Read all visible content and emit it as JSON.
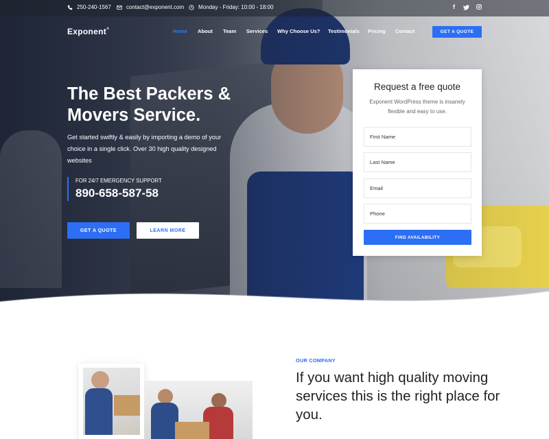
{
  "topbar": {
    "phone": "250-240-1567",
    "email": "contact@exponent.com",
    "hours": "Monday - Friday: 10:00 - 18:00",
    "socials": [
      "facebook-icon",
      "twitter-icon",
      "instagram-icon"
    ]
  },
  "nav": {
    "logo": "Exponent",
    "items": [
      "Home",
      "About",
      "Team",
      "Services",
      "Why Choose Us?",
      "Testimonials",
      "Pricing",
      "Contact"
    ],
    "active": "Home",
    "cta": "GET A QUOTE"
  },
  "hero": {
    "title_line1": "The Best Packers &",
    "title_line2": "Movers Service.",
    "description": "Get started swiftly & easily by importing a demo of your choice in a single click. Over 30 high quality designed websites",
    "support_label": "FOR 24/7 EMERGENCY SUPPORT",
    "support_phone": "890-658-587-58",
    "btn_quote": "GET A QUOTE",
    "btn_more": "LEARN MORE"
  },
  "quote_form": {
    "title": "Request a free quote",
    "subtitle": "Exponent WordPress theme is insanely flexible and easy to use.",
    "fields": [
      "First Name",
      "Last Name",
      "Email",
      "Phone"
    ],
    "submit": "FIND AVAILABILITY"
  },
  "company": {
    "eyebrow": "OUR COMPANY",
    "title": "If you want high quality moving services this is the right place for you."
  },
  "colors": {
    "accent": "#2c6ff5",
    "text_dark": "#222222"
  }
}
